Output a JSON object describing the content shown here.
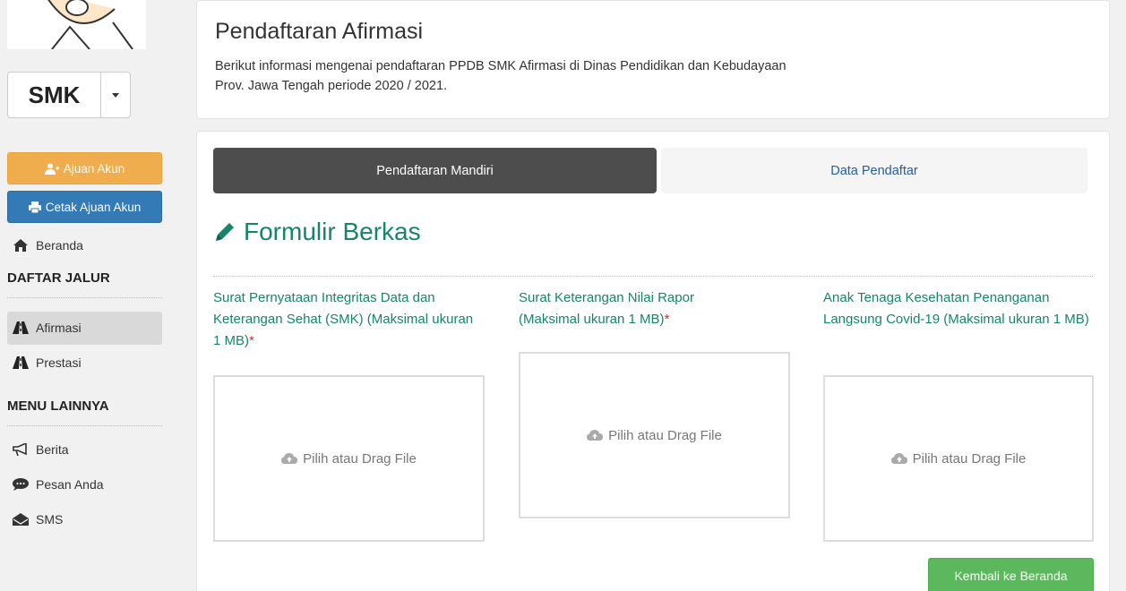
{
  "sidebar": {
    "level_select": {
      "value": "SMK"
    },
    "buttons": {
      "ajuan_akun": "Ajuan Akun",
      "cetak_ajuan_akun": "Cetak Ajuan Akun"
    },
    "beranda": "Beranda",
    "section_daftar_jalur": "DAFTAR JALUR",
    "jalur_items": [
      {
        "label": "Afirmasi",
        "icon": "road-icon",
        "active": true
      },
      {
        "label": "Prestasi",
        "icon": "road-icon",
        "active": false
      }
    ],
    "section_menu_lainnya": "MENU LAINNYA",
    "menu_items": [
      {
        "label": "Berita",
        "icon": "bullhorn-icon"
      },
      {
        "label": "Pesan Anda",
        "icon": "comment-icon"
      },
      {
        "label": "SMS",
        "icon": "envelope-icon"
      }
    ]
  },
  "header": {
    "title": "Pendaftaran Afirmasi",
    "description": "Berikut informasi mengenai pendaftaran PPDB SMK Afirmasi di Dinas Pendidikan dan Kebudayaan Prov. Jawa Tengah periode 2020 / 2021."
  },
  "tabs": [
    {
      "label": "Pendaftaran Mandiri",
      "active": true
    },
    {
      "label": "Data Pendaftar",
      "active": false
    }
  ],
  "form": {
    "title": "Formulir Berkas",
    "fields": [
      {
        "label": "Surat Pernyataan Integritas Data dan Keterangan Sehat (SMK) (Maksimal ukuran 1 MB)",
        "required": "*",
        "upload_text": "Pilih atau Drag File"
      },
      {
        "label": "Surat Keterangan Nilai Rapor (Maksimal ukuran 1 MB)",
        "required": "*",
        "upload_text": "Pilih atau Drag File"
      },
      {
        "label": "Anak Tenaga Kesehatan Penanganan Langsung Covid-19 (Maksimal ukuran 1 MB)",
        "required": "",
        "upload_text": "Pilih atau Drag File"
      }
    ],
    "back_button": "Kembali ke Beranda"
  },
  "colors": {
    "accent_green": "#17846d",
    "warning": "#f0ad4e",
    "primary": "#337ab7",
    "success": "#5cb85c",
    "tab_active": "#4d4d4d"
  }
}
